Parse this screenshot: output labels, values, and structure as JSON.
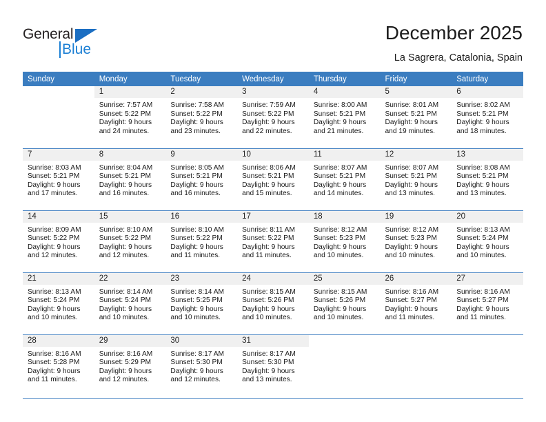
{
  "brand": {
    "name_part1": "General",
    "name_part2": "Blue",
    "triangle_color": "#1b6ec2",
    "blue_color": "#1b7fd4"
  },
  "header": {
    "title": "December 2025",
    "subtitle": "La Sagrera, Catalonia, Spain",
    "header_bg": "#3b7dc0",
    "row_divider_color": "#4a86c5",
    "date_band_bg": "#f0f0f0"
  },
  "weekday_headers": [
    "Sunday",
    "Monday",
    "Tuesday",
    "Wednesday",
    "Thursday",
    "Friday",
    "Saturday"
  ],
  "weeks": [
    [
      {
        "day": "",
        "blank": true,
        "sunrise": "",
        "sunset": "",
        "daylight1": "",
        "daylight2": ""
      },
      {
        "day": "1",
        "sunrise": "Sunrise: 7:57 AM",
        "sunset": "Sunset: 5:22 PM",
        "daylight1": "Daylight: 9 hours",
        "daylight2": "and 24 minutes."
      },
      {
        "day": "2",
        "sunrise": "Sunrise: 7:58 AM",
        "sunset": "Sunset: 5:22 PM",
        "daylight1": "Daylight: 9 hours",
        "daylight2": "and 23 minutes."
      },
      {
        "day": "3",
        "sunrise": "Sunrise: 7:59 AM",
        "sunset": "Sunset: 5:22 PM",
        "daylight1": "Daylight: 9 hours",
        "daylight2": "and 22 minutes."
      },
      {
        "day": "4",
        "sunrise": "Sunrise: 8:00 AM",
        "sunset": "Sunset: 5:21 PM",
        "daylight1": "Daylight: 9 hours",
        "daylight2": "and 21 minutes."
      },
      {
        "day": "5",
        "sunrise": "Sunrise: 8:01 AM",
        "sunset": "Sunset: 5:21 PM",
        "daylight1": "Daylight: 9 hours",
        "daylight2": "and 19 minutes."
      },
      {
        "day": "6",
        "sunrise": "Sunrise: 8:02 AM",
        "sunset": "Sunset: 5:21 PM",
        "daylight1": "Daylight: 9 hours",
        "daylight2": "and 18 minutes."
      }
    ],
    [
      {
        "day": "7",
        "sunrise": "Sunrise: 8:03 AM",
        "sunset": "Sunset: 5:21 PM",
        "daylight1": "Daylight: 9 hours",
        "daylight2": "and 17 minutes."
      },
      {
        "day": "8",
        "sunrise": "Sunrise: 8:04 AM",
        "sunset": "Sunset: 5:21 PM",
        "daylight1": "Daylight: 9 hours",
        "daylight2": "and 16 minutes."
      },
      {
        "day": "9",
        "sunrise": "Sunrise: 8:05 AM",
        "sunset": "Sunset: 5:21 PM",
        "daylight1": "Daylight: 9 hours",
        "daylight2": "and 16 minutes."
      },
      {
        "day": "10",
        "sunrise": "Sunrise: 8:06 AM",
        "sunset": "Sunset: 5:21 PM",
        "daylight1": "Daylight: 9 hours",
        "daylight2": "and 15 minutes."
      },
      {
        "day": "11",
        "sunrise": "Sunrise: 8:07 AM",
        "sunset": "Sunset: 5:21 PM",
        "daylight1": "Daylight: 9 hours",
        "daylight2": "and 14 minutes."
      },
      {
        "day": "12",
        "sunrise": "Sunrise: 8:07 AM",
        "sunset": "Sunset: 5:21 PM",
        "daylight1": "Daylight: 9 hours",
        "daylight2": "and 13 minutes."
      },
      {
        "day": "13",
        "sunrise": "Sunrise: 8:08 AM",
        "sunset": "Sunset: 5:21 PM",
        "daylight1": "Daylight: 9 hours",
        "daylight2": "and 13 minutes."
      }
    ],
    [
      {
        "day": "14",
        "sunrise": "Sunrise: 8:09 AM",
        "sunset": "Sunset: 5:22 PM",
        "daylight1": "Daylight: 9 hours",
        "daylight2": "and 12 minutes."
      },
      {
        "day": "15",
        "sunrise": "Sunrise: 8:10 AM",
        "sunset": "Sunset: 5:22 PM",
        "daylight1": "Daylight: 9 hours",
        "daylight2": "and 12 minutes."
      },
      {
        "day": "16",
        "sunrise": "Sunrise: 8:10 AM",
        "sunset": "Sunset: 5:22 PM",
        "daylight1": "Daylight: 9 hours",
        "daylight2": "and 11 minutes."
      },
      {
        "day": "17",
        "sunrise": "Sunrise: 8:11 AM",
        "sunset": "Sunset: 5:22 PM",
        "daylight1": "Daylight: 9 hours",
        "daylight2": "and 11 minutes."
      },
      {
        "day": "18",
        "sunrise": "Sunrise: 8:12 AM",
        "sunset": "Sunset: 5:23 PM",
        "daylight1": "Daylight: 9 hours",
        "daylight2": "and 10 minutes."
      },
      {
        "day": "19",
        "sunrise": "Sunrise: 8:12 AM",
        "sunset": "Sunset: 5:23 PM",
        "daylight1": "Daylight: 9 hours",
        "daylight2": "and 10 minutes."
      },
      {
        "day": "20",
        "sunrise": "Sunrise: 8:13 AM",
        "sunset": "Sunset: 5:24 PM",
        "daylight1": "Daylight: 9 hours",
        "daylight2": "and 10 minutes."
      }
    ],
    [
      {
        "day": "21",
        "sunrise": "Sunrise: 8:13 AM",
        "sunset": "Sunset: 5:24 PM",
        "daylight1": "Daylight: 9 hours",
        "daylight2": "and 10 minutes."
      },
      {
        "day": "22",
        "sunrise": "Sunrise: 8:14 AM",
        "sunset": "Sunset: 5:24 PM",
        "daylight1": "Daylight: 9 hours",
        "daylight2": "and 10 minutes."
      },
      {
        "day": "23",
        "sunrise": "Sunrise: 8:14 AM",
        "sunset": "Sunset: 5:25 PM",
        "daylight1": "Daylight: 9 hours",
        "daylight2": "and 10 minutes."
      },
      {
        "day": "24",
        "sunrise": "Sunrise: 8:15 AM",
        "sunset": "Sunset: 5:26 PM",
        "daylight1": "Daylight: 9 hours",
        "daylight2": "and 10 minutes."
      },
      {
        "day": "25",
        "sunrise": "Sunrise: 8:15 AM",
        "sunset": "Sunset: 5:26 PM",
        "daylight1": "Daylight: 9 hours",
        "daylight2": "and 10 minutes."
      },
      {
        "day": "26",
        "sunrise": "Sunrise: 8:16 AM",
        "sunset": "Sunset: 5:27 PM",
        "daylight1": "Daylight: 9 hours",
        "daylight2": "and 11 minutes."
      },
      {
        "day": "27",
        "sunrise": "Sunrise: 8:16 AM",
        "sunset": "Sunset: 5:27 PM",
        "daylight1": "Daylight: 9 hours",
        "daylight2": "and 11 minutes."
      }
    ],
    [
      {
        "day": "28",
        "sunrise": "Sunrise: 8:16 AM",
        "sunset": "Sunset: 5:28 PM",
        "daylight1": "Daylight: 9 hours",
        "daylight2": "and 11 minutes."
      },
      {
        "day": "29",
        "sunrise": "Sunrise: 8:16 AM",
        "sunset": "Sunset: 5:29 PM",
        "daylight1": "Daylight: 9 hours",
        "daylight2": "and 12 minutes."
      },
      {
        "day": "30",
        "sunrise": "Sunrise: 8:17 AM",
        "sunset": "Sunset: 5:30 PM",
        "daylight1": "Daylight: 9 hours",
        "daylight2": "and 12 minutes."
      },
      {
        "day": "31",
        "sunrise": "Sunrise: 8:17 AM",
        "sunset": "Sunset: 5:30 PM",
        "daylight1": "Daylight: 9 hours",
        "daylight2": "and 13 minutes."
      },
      {
        "day": "",
        "blank": true,
        "sunrise": "",
        "sunset": "",
        "daylight1": "",
        "daylight2": ""
      },
      {
        "day": "",
        "blank": true,
        "sunrise": "",
        "sunset": "",
        "daylight1": "",
        "daylight2": ""
      },
      {
        "day": "",
        "blank": true,
        "sunrise": "",
        "sunset": "",
        "daylight1": "",
        "daylight2": ""
      }
    ]
  ]
}
